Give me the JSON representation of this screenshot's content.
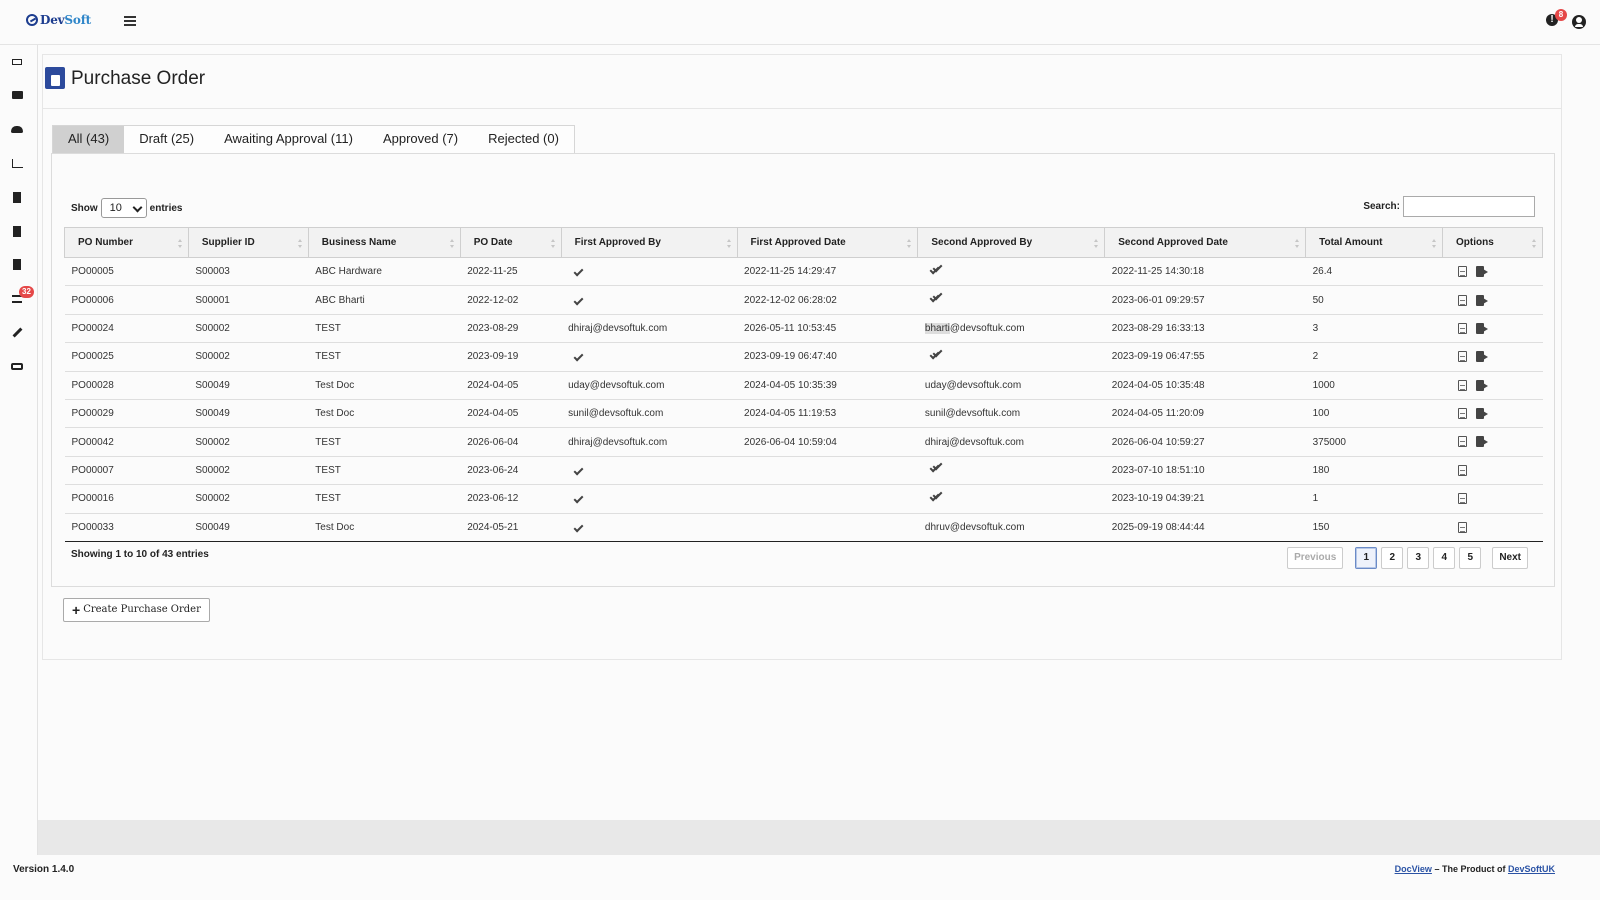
{
  "brand": {
    "logo_a": "Dev",
    "logo_b": "Soft"
  },
  "header": {
    "notification_count": "8"
  },
  "sidebar": {
    "tasks_badge": "32"
  },
  "page": {
    "title": "Purchase Order"
  },
  "tabs": [
    {
      "label": "All (43)",
      "active": true
    },
    {
      "label": "Draft (25)"
    },
    {
      "label": "Awaiting Approval (11)"
    },
    {
      "label": "Approved (7)"
    },
    {
      "label": "Rejected (0)"
    }
  ],
  "table_controls": {
    "show_label": "Show",
    "entries_value": "10",
    "entries_label": "entries",
    "search_label": "Search:"
  },
  "columns": [
    "PO Number",
    "Supplier ID",
    "Business Name",
    "PO Date",
    "First Approved By",
    "First Approved Date",
    "Second Approved By",
    "Second Approved Date",
    "Total Amount",
    "Options"
  ],
  "rows": [
    {
      "po": "PO00005",
      "supplier": "S00003",
      "business": "ABC Hardware",
      "po_date": "2022-11-25",
      "first_by": "",
      "first_date": "2022-11-25 14:29:47",
      "second_by": "",
      "second_date": "2022-11-25 14:30:18",
      "total": "26.4"
    },
    {
      "po": "PO00006",
      "supplier": "S00001",
      "business": "ABC Bharti",
      "po_date": "2022-12-02",
      "first_by": "",
      "first_date": "2022-12-02 06:28:02",
      "second_by": "",
      "second_date": "2023-06-01 09:29:57",
      "total": "50"
    },
    {
      "po": "PO00024",
      "supplier": "S00002",
      "business": "TEST",
      "po_date": "2023-08-29",
      "first_by": "dhiraj@devsoftuk.com",
      "first_date": "2026-05-11 10:53:45",
      "second_by_hl": "bharti",
      "second_by": "@devsoftuk.com",
      "second_date": "2023-08-29 16:33:13",
      "total": "3"
    },
    {
      "po": "PO00025",
      "supplier": "S00002",
      "business": "TEST",
      "po_date": "2023-09-19",
      "first_by": "",
      "first_date": "2023-09-19 06:47:40",
      "second_by": "",
      "second_date": "2023-09-19 06:47:55",
      "total": "2"
    },
    {
      "po": "PO00028",
      "supplier": "S00049",
      "business": "Test Doc",
      "po_date": "2024-04-05",
      "first_by": "uday@devsoftuk.com",
      "first_date": "2024-04-05 10:35:39",
      "second_by": "uday@devsoftuk.com",
      "second_date": "2024-04-05 10:35:48",
      "total": "1000"
    },
    {
      "po": "PO00029",
      "supplier": "S00049",
      "business": "Test Doc",
      "po_date": "2024-04-05",
      "first_by": "sunil@devsoftuk.com",
      "first_date": "2024-04-05 11:19:53",
      "second_by": "sunil@devsoftuk.com",
      "second_date": "2024-04-05 11:20:09",
      "total": "100"
    },
    {
      "po": "PO00042",
      "supplier": "S00002",
      "business": "TEST",
      "po_date": "2026-06-04",
      "first_by": "dhiraj@devsoftuk.com",
      "first_date": "2026-06-04 10:59:04",
      "second_by": "dhiraj@devsoftuk.com",
      "second_date": "2026-06-04 10:59:27",
      "total": "375000"
    },
    {
      "po": "PO00007",
      "supplier": "S00002",
      "business": "TEST",
      "po_date": "2023-06-24",
      "first_by": "",
      "first_date": "",
      "second_by": "",
      "second_date": "2023-07-10 18:51:10",
      "total": "180"
    },
    {
      "po": "PO00016",
      "supplier": "S00002",
      "business": "TEST",
      "po_date": "2023-06-12",
      "first_by": "",
      "first_date": "",
      "second_by": "",
      "second_date": "2023-10-19 04:39:21",
      "total": "1"
    },
    {
      "po": "PO00033",
      "supplier": "S00049",
      "business": "Test Doc",
      "po_date": "2024-05-21",
      "first_by": "",
      "first_date": "",
      "second_by": "dhruv@devsoftuk.com",
      "second_date": "2025-09-19 08:44:44",
      "total": "150"
    }
  ],
  "pagination": {
    "info": "Showing 1 to 10 of 43 entries",
    "previous": "Previous",
    "pages": [
      "1",
      "2",
      "3",
      "4",
      "5"
    ],
    "next": "Next"
  },
  "actions": {
    "create_label": "Create Purchase Order"
  },
  "footer": {
    "version": "Version 1.4.0",
    "product_link": "DocView",
    "separator": "–  The Product of",
    "company_link": "DevSoftUK"
  }
}
